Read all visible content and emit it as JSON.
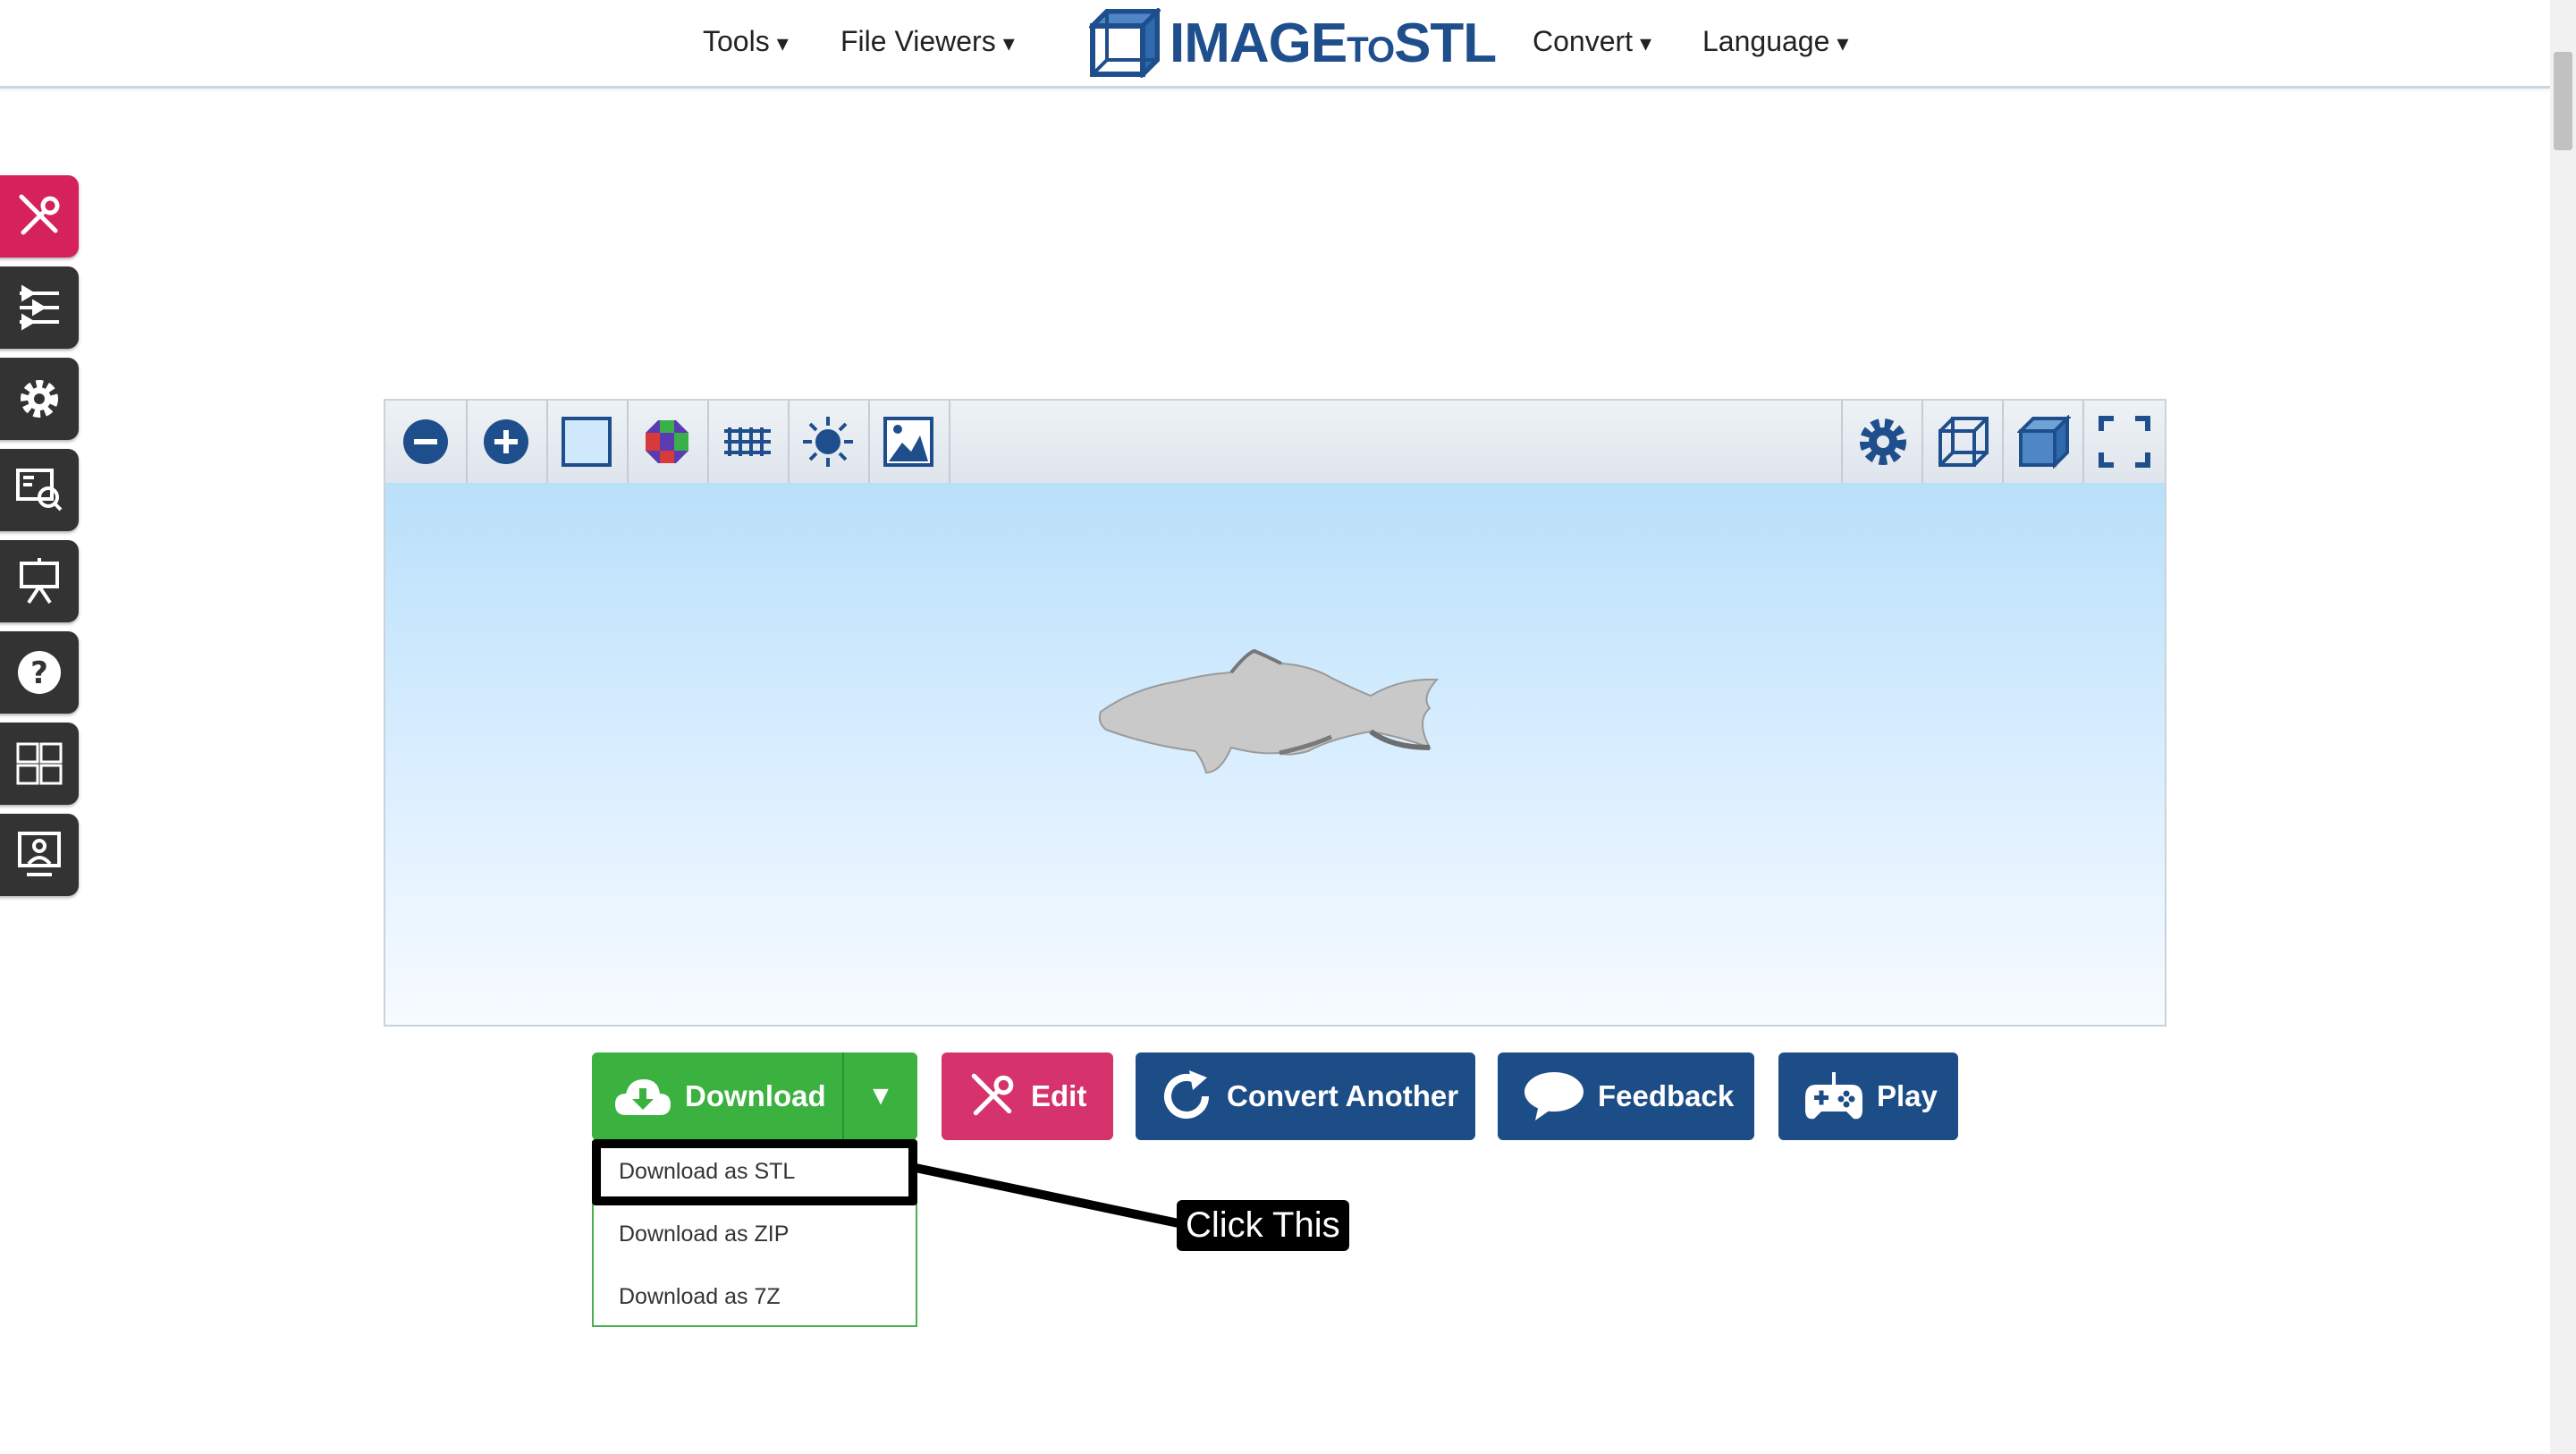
{
  "nav": {
    "tools": "Tools",
    "file_viewers": "File Viewers",
    "convert": "Convert",
    "language": "Language",
    "caret": "▾",
    "logo_main": "IMAGE",
    "logo_small": "TO",
    "logo_end": "STL"
  },
  "actions": {
    "download": "Download",
    "split_caret": "▼",
    "edit": "Edit",
    "convert_another": "Convert Another",
    "feedback": "Feedback",
    "play": "Play"
  },
  "download_menu": {
    "items": [
      "Download as STL",
      "Download as ZIP",
      "Download as 7Z"
    ]
  },
  "annotation": {
    "callout": "Click This"
  },
  "colors": {
    "brand_blue": "#1f4e8c",
    "download_green": "#3bb13f",
    "edit_pink": "#d6336c",
    "button_blue": "#1d4d86",
    "side_active": "#d6225b"
  },
  "icons": {
    "side": [
      "tools-icon",
      "sliders-icon",
      "gear-icon",
      "search-doc-icon",
      "presentation-icon",
      "help-icon",
      "grid-icon",
      "user-screen-icon"
    ],
    "viewer_left": [
      "zoom-out-icon",
      "zoom-in-icon",
      "background-icon",
      "color-icon",
      "grid-plane-icon",
      "light-icon",
      "image-icon"
    ],
    "viewer_right": [
      "settings-icon",
      "wireframe-icon",
      "solid-icon",
      "fullscreen-icon"
    ]
  }
}
